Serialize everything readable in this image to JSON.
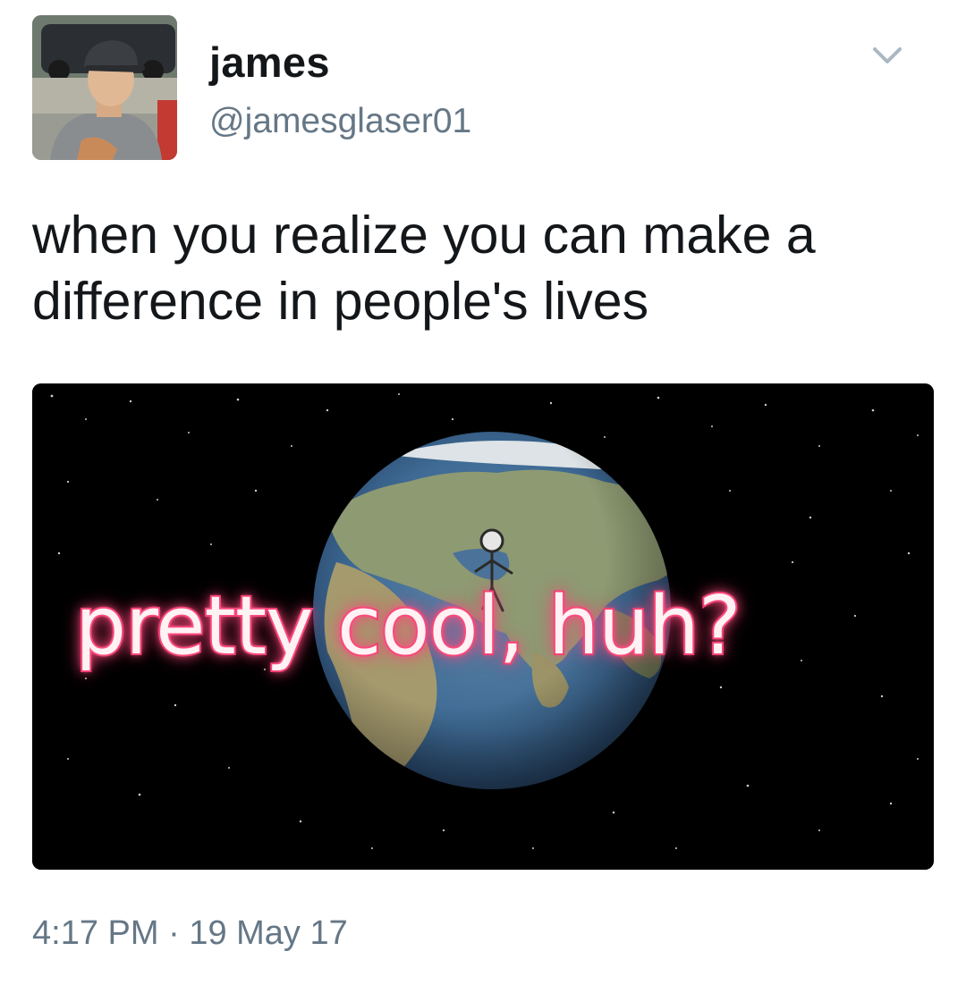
{
  "tweet": {
    "author": {
      "display_name": "james",
      "handle": "@jamesglaser01"
    },
    "text_line_1": "when you realize you can make a",
    "text_line_2": "difference in people's lives",
    "media": {
      "caption": "pretty cool, huh?"
    },
    "time": "4:17 PM",
    "separator": "·",
    "date": "19 May 17"
  },
  "colors": {
    "text_primary": "#14171a",
    "text_secondary": "#657786",
    "caption_glow": "#f23a6b",
    "space_background": "#000000"
  },
  "icons": {
    "menu": "chevron-down-icon"
  }
}
